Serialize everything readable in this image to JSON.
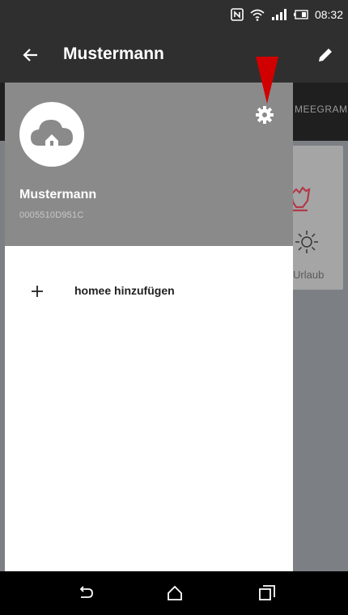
{
  "status_bar": {
    "time": "08:32",
    "icons": [
      "nfc-icon",
      "wifi-icon",
      "signal-icon",
      "battery-icon"
    ]
  },
  "app_bar": {
    "title": "Mustermann",
    "back_icon": "arrow-left-icon",
    "edit_icon": "pencil-icon"
  },
  "background_screen": {
    "tab_label": "MEEGRAM",
    "card_label": "Urlaub",
    "card_icons": [
      "hand-icon",
      "sun-icon"
    ]
  },
  "drawer": {
    "account": {
      "name": "Mustermann",
      "id": "0005510D951C",
      "avatar_icon": "cloud-home-icon"
    },
    "settings_icon": "gear-icon",
    "annotation_icon": "red-arrow-down-icon",
    "items": [
      {
        "icon": "plus-icon",
        "label": "homee hinzufügen"
      }
    ]
  },
  "nav_bar": {
    "buttons": [
      "back-icon",
      "home-icon",
      "recents-icon"
    ]
  },
  "colors": {
    "status_app_bar": "#2f2f2f",
    "drawer_header": "#8a8a8a",
    "annotation_red": "#d10000",
    "nav_bar": "#000000"
  }
}
